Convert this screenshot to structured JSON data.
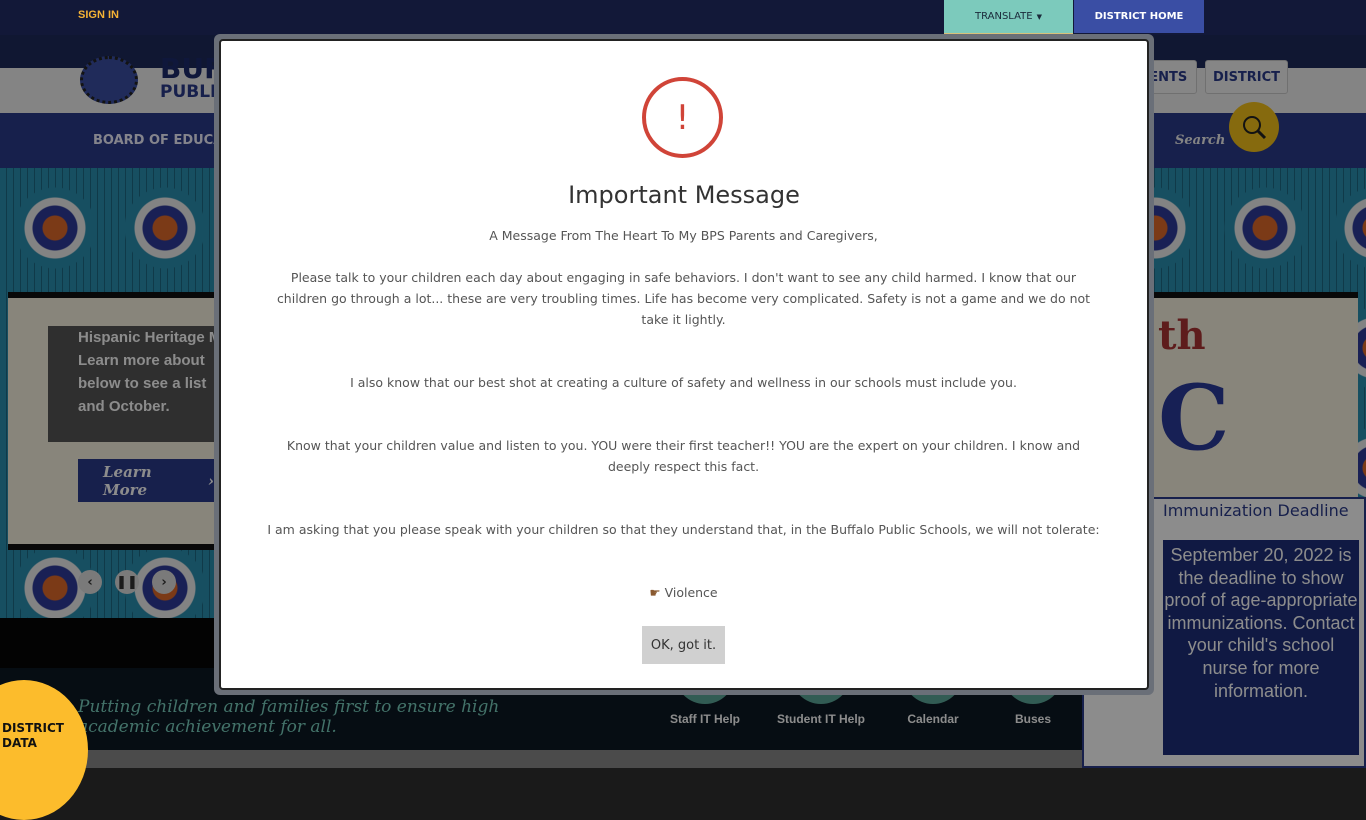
{
  "topbar": {
    "sign_in": "SIGN IN",
    "translate": "TRANSLATE",
    "district_home": "DISTRICT HOME"
  },
  "header": {
    "logo_text_1": "BUFFALO",
    "logo_text_2": "PUBLIC SCHOOLS",
    "tabs": [
      "STUDENTS",
      "DISTRICT"
    ]
  },
  "nav": {
    "first_item": "BOARD OF EDUCATION",
    "search_label": "Search"
  },
  "hero": {
    "text": [
      "Hispanic Heritage Month",
      "Learn more about",
      "below to see a list",
      "and October."
    ],
    "learn_more": "Learn More",
    "right_text_1": "th",
    "right_text_2": "C"
  },
  "footer": {
    "tagline_1": "Putting children and families first to ensure high",
    "tagline_2": "academic achievement for all.",
    "quick_links": [
      "Staff IT Help",
      "Student IT Help",
      "Calendar",
      "Buses"
    ],
    "district_data": [
      "DISTRICT",
      "DATA"
    ]
  },
  "immunization": {
    "title": "Immunization Deadline",
    "body": "September 20, 2022 is the deadline to show proof of age-appropriate immunizations. Contact your child's school nurse for more information."
  },
  "modal": {
    "icon": "!",
    "title": "Important Message",
    "paragraphs": [
      "A Message From The Heart To My BPS Parents and Caregivers,",
      "Please talk to your children each day about engaging in safe behaviors. I don't want to see any child harmed. I know that our children go through a lot... these are very troubling times.  Life has become very complicated. Safety is not a game and we do not take it lightly.",
      "I also know that our best shot at creating a culture of safety and wellness in our schools must  include you.",
      "Know that your children value and listen to you. YOU were their first teacher!! YOU are the expert on your children. I know and deeply respect this fact.",
      "I am asking that you please speak with your children so that they understand that, in the Buffalo Public Schools, we will not tolerate:",
      "Violence"
    ],
    "ok_button": "OK, got it."
  },
  "colors": {
    "navy": "#121838",
    "accent_yellow": "#f5b335",
    "translate_bg": "#7ccabc",
    "district_home_bg": "#3a4ea4",
    "alert_red": "#d04438"
  }
}
